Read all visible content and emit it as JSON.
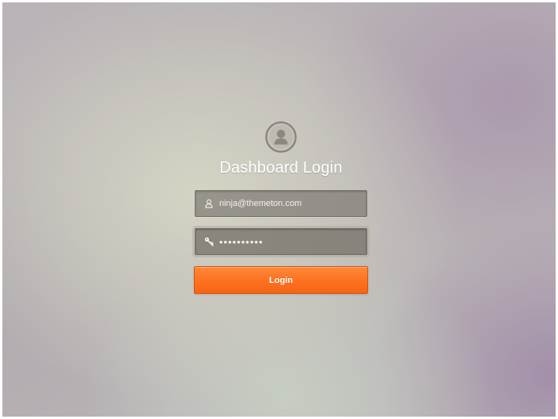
{
  "login": {
    "title": "Dashboard Login",
    "avatar_icon": "user-avatar-icon",
    "email": {
      "icon": "user-icon",
      "value": "ninja@themeton.com"
    },
    "password": {
      "icon": "key-icon",
      "value": "••••••••••"
    },
    "button_label": "Login"
  },
  "colors": {
    "accent": "#fd7322",
    "title_text": "#ffffff"
  }
}
